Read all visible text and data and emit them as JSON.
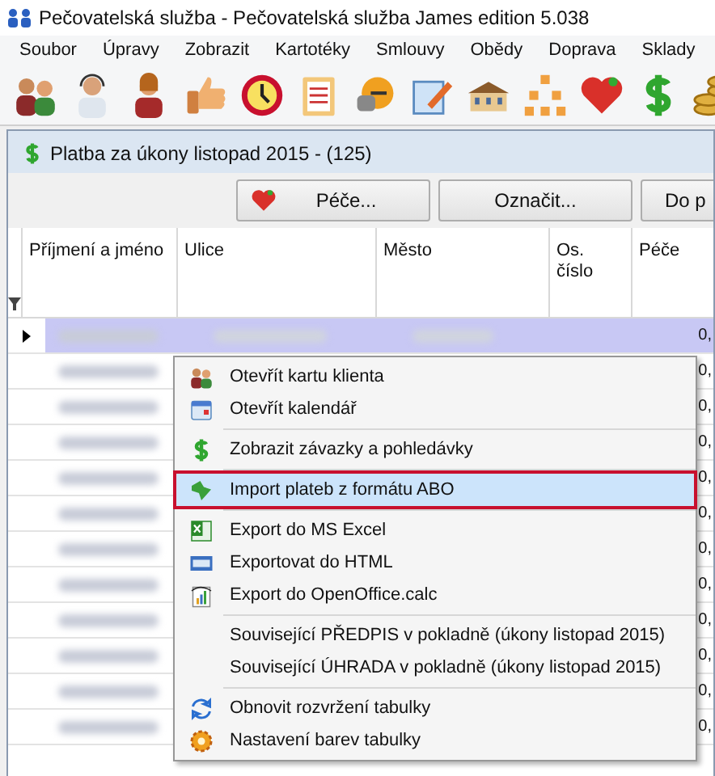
{
  "window": {
    "title": "Pečovatelská služba - Pečovatelská služba James edition 5.038"
  },
  "menu": [
    "Soubor",
    "Úpravy",
    "Zobrazit",
    "Kartotéky",
    "Smlouvy",
    "Obědy",
    "Doprava",
    "Sklady"
  ],
  "child_window": {
    "title": "Platba za úkony listopad 2015 - (125)",
    "buttons": [
      {
        "label": "Péče..."
      },
      {
        "label": "Označit..."
      },
      {
        "label": "Do p"
      }
    ],
    "columns": [
      "Příjmení a jméno",
      "Ulice",
      "Město",
      "Os. číslo",
      "Péče"
    ],
    "rows": [
      {
        "pece": "0,",
        "selected": true
      },
      {
        "pece": "0,",
        "selected": false
      },
      {
        "pece": "0,",
        "selected": false
      },
      {
        "pece": "0,",
        "selected": false
      },
      {
        "pece": "0,",
        "selected": false
      },
      {
        "pece": "0,",
        "selected": false
      },
      {
        "pece": "0,",
        "selected": false
      },
      {
        "pece": "0,",
        "selected": false
      },
      {
        "pece": "0,",
        "selected": false
      },
      {
        "pece": "0,",
        "selected": false
      },
      {
        "pece": "0,",
        "selected": false
      },
      {
        "pece": "0,",
        "selected": false
      }
    ]
  },
  "context_menu": [
    {
      "kind": "item",
      "label": "Otevřít kartu klienta",
      "selected": false
    },
    {
      "kind": "item",
      "label": "Otevřít kalendář",
      "selected": false
    },
    {
      "kind": "separator"
    },
    {
      "kind": "item",
      "label": "Zobrazit závazky a pohledávky",
      "selected": false
    },
    {
      "kind": "separator"
    },
    {
      "kind": "item",
      "label": "Import plateb z formátu ABO",
      "selected": true
    },
    {
      "kind": "separator"
    },
    {
      "kind": "item",
      "label": "Export do MS Excel",
      "selected": false
    },
    {
      "kind": "item",
      "label": "Exportovat do HTML",
      "selected": false
    },
    {
      "kind": "item",
      "label": "Export do OpenOffice.calc",
      "selected": false
    },
    {
      "kind": "separator"
    },
    {
      "kind": "item",
      "label": "Související PŘEDPIS v pokladně (úkony listopad 2015)",
      "selected": false
    },
    {
      "kind": "item",
      "label": "Související ÚHRADA v pokladně (úkony listopad 2015)",
      "selected": false
    },
    {
      "kind": "separator"
    },
    {
      "kind": "item",
      "label": "Obnovit rozvržení tabulky",
      "selected": false
    },
    {
      "kind": "item",
      "label": "Nastavení barev tabulky",
      "selected": false
    }
  ]
}
